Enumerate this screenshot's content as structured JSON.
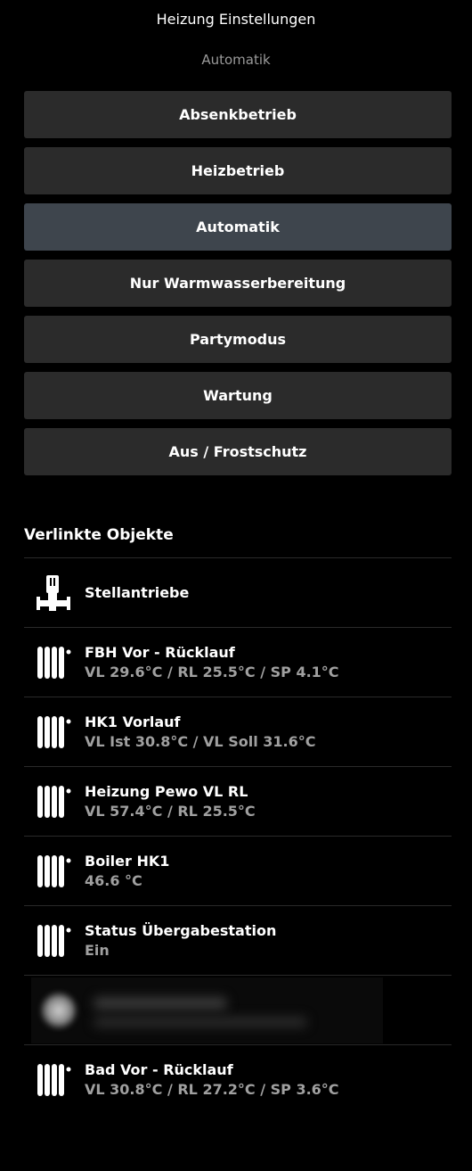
{
  "header": {
    "title": "Heizung Einstellungen",
    "current_mode": "Automatik"
  },
  "modes": [
    {
      "label": "Absenkbetrieb",
      "active": false
    },
    {
      "label": "Heizbetrieb",
      "active": false
    },
    {
      "label": "Automatik",
      "active": true
    },
    {
      "label": "Nur Warmwasserbereitung",
      "active": false
    },
    {
      "label": "Partymodus",
      "active": false
    },
    {
      "label": "Wartung",
      "active": false
    },
    {
      "label": "Aus / Frostschutz",
      "active": false
    }
  ],
  "linked": {
    "title": "Verlinkte Objekte",
    "items": [
      {
        "icon": "valve-actuator-icon",
        "name": "Stellantriebe",
        "value": ""
      },
      {
        "icon": "radiator-icon",
        "name": "FBH Vor - Rücklauf",
        "value": "VL 29.6°C / RL 25.5°C / SP 4.1°C"
      },
      {
        "icon": "radiator-icon",
        "name": "HK1 Vorlauf",
        "value": "VL Ist 30.8°C / VL Soll 31.6°C"
      },
      {
        "icon": "radiator-icon",
        "name": "Heizung Pewo VL RL",
        "value": "VL 57.4°C / RL 25.5°C"
      },
      {
        "icon": "radiator-icon",
        "name": "Boiler HK1",
        "value": "46.6 °C"
      },
      {
        "icon": "radiator-icon",
        "name": "Status Übergabestation",
        "value": "Ein"
      },
      {
        "icon": "radiator-icon",
        "name": "Bad Vor - Rücklauf",
        "value": "VL 30.8°C / RL 27.2°C / SP 3.6°C"
      }
    ]
  },
  "colors": {
    "background": "#000000",
    "button": "#2b2b2b",
    "button_active": "#3e454d",
    "secondary_text": "#a0a0a0"
  }
}
